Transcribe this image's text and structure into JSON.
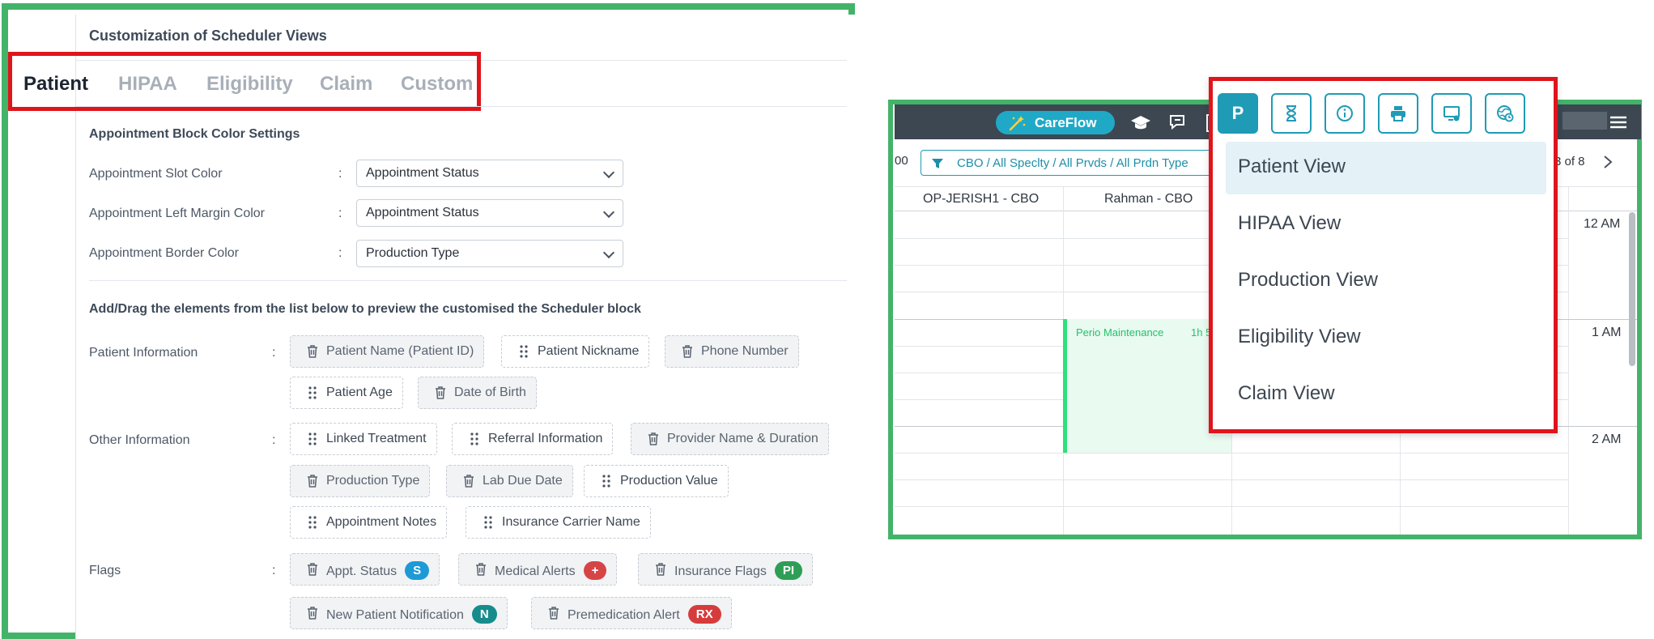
{
  "colors": {
    "frame_green": "#44b36a",
    "highlight_red": "#e0141b",
    "accent_teal": "#1f9bb5"
  },
  "left": {
    "panel_title": "Customization of Scheduler Views",
    "tabs": [
      "Patient",
      "HIPAA",
      "Eligibility",
      "Claim",
      "Custom"
    ],
    "active_tab": "Patient",
    "color_settings": {
      "heading": "Appointment Block Color Settings",
      "rows": [
        {
          "label": "Appointment Slot Color",
          "value": "Appointment Status"
        },
        {
          "label": "Appointment Left Margin Color",
          "value": "Appointment Status"
        },
        {
          "label": "Appointment Border Color",
          "value": "Production Type"
        }
      ]
    },
    "drag_heading": "Add/Drag the elements from the list below to preview the customised the Scheduler block",
    "groups": {
      "patient_information": {
        "label": "Patient Information",
        "chips": [
          "Patient Name (Patient ID)",
          "Patient Nickname",
          "Phone Number",
          "Patient Age",
          "Date of Birth"
        ]
      },
      "other_information": {
        "label": "Other Information",
        "chips": [
          "Linked Treatment",
          "Referral Information",
          "Provider Name & Duration",
          "Production Type",
          "Lab Due Date",
          "Production Value",
          "Appointment Notes",
          "Insurance Carrier Name"
        ]
      },
      "flags": {
        "label": "Flags",
        "chips": [
          "Appt. Status",
          "Medical Alerts",
          "Insurance Flags",
          "New Patient Notification",
          "Premedication Alert"
        ],
        "badges": [
          "S",
          "+",
          "PI",
          "N",
          "RX"
        ],
        "badge_colors": [
          "#1e9ad6",
          "#d64545",
          "#2e9e57",
          "#168c8c",
          "#d63c3c"
        ]
      }
    },
    "colon": ":"
  },
  "right": {
    "careflow_label": "CareFlow",
    "filter_text": "CBO / All Speclty / All Prvds / All Prdn Type",
    "left_cut_label": "00",
    "pagination": "3 of 8",
    "columns": [
      "OP-JERISH1 - CBO",
      "Rahman - CBO"
    ],
    "times": [
      "12 AM",
      "1 AM",
      "2 AM"
    ],
    "appointment": {
      "label": "Perio Maintenance",
      "duration": "1h 5"
    },
    "view_button_active": "P",
    "view_buttons": [
      "hourglass-icon",
      "info-icon",
      "printer-icon",
      "monitor-user-icon",
      "globe-clock-icon"
    ],
    "view_menu": [
      "Patient View",
      "HIPAA View",
      "Production View",
      "Eligibility View",
      "Claim View"
    ],
    "selected_view": "Patient View"
  }
}
